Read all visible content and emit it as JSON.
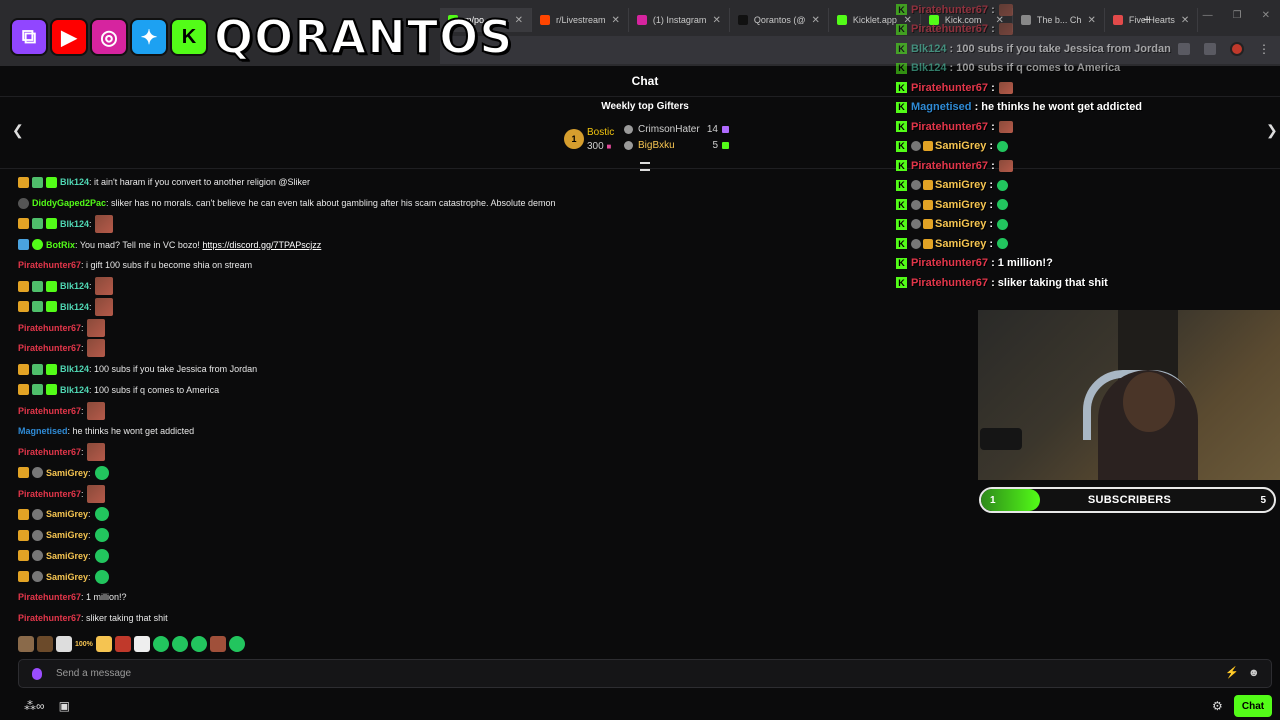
{
  "browser": {
    "tabs": [
      {
        "title": "m/po",
        "active": true,
        "color": "#53fc18"
      },
      {
        "title": "r/Livestream",
        "active": false,
        "color": "#ff4500"
      },
      {
        "title": "(1) Instagram",
        "active": false,
        "color": "#d6249f"
      },
      {
        "title": "Qorantos (@",
        "active": false,
        "color": "#111111"
      },
      {
        "title": "Kicklet.app",
        "active": false,
        "color": "#53fc18"
      },
      {
        "title": "Kick.com",
        "active": false,
        "color": "#53fc18"
      },
      {
        "title": "The b... Ch",
        "active": false,
        "color": "#888888"
      },
      {
        "title": "Five Hearts",
        "active": false,
        "color": "#e24a4a"
      }
    ],
    "new_tab": "+"
  },
  "overlay_logo": {
    "text": "QORANTOS",
    "socials": [
      "twitch-icon",
      "youtube-icon",
      "instagram-icon",
      "twitter-icon",
      "kick-icon"
    ]
  },
  "header": {
    "title": "Chat",
    "gifters_title": "Weekly top Gifters",
    "top_gifter": {
      "rank": "1",
      "name": "Bostic",
      "count": "300"
    },
    "gifters": [
      {
        "name": "CrimsonHater",
        "count": "14",
        "name_color": "#cfcfcf",
        "gift_color": "#b06bff"
      },
      {
        "name": "BigBxku",
        "count": "5",
        "name_color": "#f5c451",
        "gift_color": "#53fc18"
      }
    ]
  },
  "chat": {
    "messages": [
      {
        "user": "Blk124",
        "color": "mint",
        "badges": [
          "crown",
          "sub",
          "gift"
        ],
        "text": ": it ain't haram if you convert to another religion @Sliker"
      },
      {
        "user": "DiddyGaped2Pac",
        "color": "green",
        "badges": [
          "dark"
        ],
        "text": ": sliker has no morals. can't believe he can even talk about gambling after his scam catastrophe. Absolute demon"
      },
      {
        "user": "Blk124",
        "color": "mint",
        "badges": [
          "crown",
          "sub",
          "gift"
        ],
        "text": ":",
        "emote": "img"
      },
      {
        "user": "BotRix",
        "color": "green",
        "badges": [
          "bot",
          "verified"
        ],
        "text": ": You mad? Tell me in VC bozo! ",
        "link": "https://discord.gg/7TPAPscjzz"
      },
      {
        "user": "Piratehunter67",
        "color": "red",
        "badges": [],
        "text": ": i gift 100 subs if u become shia on stream"
      },
      {
        "user": "Blk124",
        "color": "mint",
        "badges": [
          "crown",
          "sub",
          "gift"
        ],
        "text": ":",
        "emote": "img"
      },
      {
        "user": "Blk124",
        "color": "mint",
        "badges": [
          "crown",
          "sub",
          "gift"
        ],
        "text": ":",
        "emote": "img"
      },
      {
        "user": "Piratehunter67",
        "color": "red",
        "badges": [],
        "text": ":",
        "emote": "img"
      },
      {
        "user": "Piratehunter67",
        "color": "red",
        "badges": [],
        "text": ":",
        "emote": "img"
      },
      {
        "user": "Blk124",
        "color": "mint",
        "badges": [
          "crown",
          "sub",
          "gift"
        ],
        "text": ": 100 subs if you take Jessica from Jordan"
      },
      {
        "user": "Blk124",
        "color": "mint",
        "badges": [
          "crown",
          "sub",
          "gift"
        ],
        "text": ": 100 subs if q comes to America"
      },
      {
        "user": "Piratehunter67",
        "color": "red",
        "badges": [],
        "text": ":",
        "emote": "img"
      },
      {
        "user": "Magnetised",
        "color": "blue",
        "badges": [],
        "text": ": he thinks he wont get addicted"
      },
      {
        "user": "Piratehunter67",
        "color": "red",
        "badges": [],
        "text": ":",
        "emote": "img"
      },
      {
        "user": "SamiGrey",
        "color": "gold",
        "badges": [
          "crown",
          "gray"
        ],
        "text": ":",
        "emote": "green"
      },
      {
        "user": "Piratehunter67",
        "color": "red",
        "badges": [],
        "text": ":",
        "emote": "img"
      },
      {
        "user": "SamiGrey",
        "color": "gold",
        "badges": [
          "crown",
          "gray"
        ],
        "text": ":",
        "emote": "green"
      },
      {
        "user": "SamiGrey",
        "color": "gold",
        "badges": [
          "crown",
          "gray"
        ],
        "text": ":",
        "emote": "green"
      },
      {
        "user": "SamiGrey",
        "color": "gold",
        "badges": [
          "crown",
          "gray"
        ],
        "text": ":",
        "emote": "green"
      },
      {
        "user": "SamiGrey",
        "color": "gold",
        "badges": [
          "crown",
          "gray"
        ],
        "text": ":",
        "emote": "green"
      },
      {
        "user": "Piratehunter67",
        "color": "red",
        "badges": [],
        "text": ": 1 million!?"
      },
      {
        "user": "Piratehunter67",
        "color": "red",
        "badges": [],
        "text": ": sliker taking that shit"
      }
    ],
    "emote_bar": [
      "#8a6a4a",
      "#6b4a2a",
      "#dddddd",
      "#f5c451",
      "#c0392b",
      "#eeeeee",
      "#22c55e",
      "#22c55e",
      "#22c55e",
      "#a0503a",
      "#22c55e"
    ],
    "emote_bar_label": "100%",
    "input_placeholder": "Send a message",
    "send_label": "Chat"
  },
  "overlay_chat": [
    {
      "user": "Piratehunter67",
      "color": "#e2364a",
      "text": " :",
      "emote": "img",
      "faded": true
    },
    {
      "user": "Piratehunter67",
      "color": "#e2364a",
      "text": " :",
      "emote": "img",
      "faded": true
    },
    {
      "user": "Blk124",
      "color": "#50d7b4",
      "text": " : 100 subs if you take Jessica from Jordan",
      "faded": true
    },
    {
      "user": "Blk124",
      "color": "#50d7b4",
      "text": " : 100 subs if q comes to America",
      "faded": true
    },
    {
      "user": "Piratehunter67",
      "color": "#e2364a",
      "text": " :",
      "emote": "img"
    },
    {
      "user": "Magnetised",
      "color": "#2f8bd6",
      "text": " : he thinks he wont get addicted"
    },
    {
      "user": "Piratehunter67",
      "color": "#e2364a",
      "text": " :",
      "emote": "img"
    },
    {
      "user": "SamiGrey",
      "color": "#f5c451",
      "text": " :",
      "emote": "green",
      "badges": true
    },
    {
      "user": "Piratehunter67",
      "color": "#e2364a",
      "text": " :",
      "emote": "img"
    },
    {
      "user": "SamiGrey",
      "color": "#f5c451",
      "text": " :",
      "emote": "green",
      "badges": true
    },
    {
      "user": "SamiGrey",
      "color": "#f5c451",
      "text": " :",
      "emote": "green",
      "badges": true
    },
    {
      "user": "SamiGrey",
      "color": "#f5c451",
      "text": " :",
      "emote": "green",
      "badges": true
    },
    {
      "user": "SamiGrey",
      "color": "#f5c451",
      "text": " :",
      "emote": "green",
      "badges": true
    },
    {
      "user": "Piratehunter67",
      "color": "#e2364a",
      "text": " : 1 million!?"
    },
    {
      "user": "Piratehunter67",
      "color": "#e2364a",
      "text": " : sliker taking that shit"
    }
  ],
  "sub_goal": {
    "current": "1",
    "label": "SUBSCRIBERS",
    "target": "5",
    "progress": 0.2
  },
  "colors": {
    "kick_green": "#53fc18",
    "background": "#0b0b0c"
  }
}
